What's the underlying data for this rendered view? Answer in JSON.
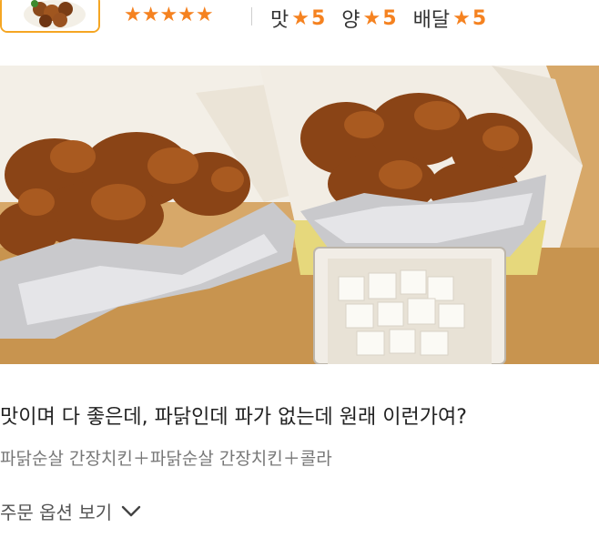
{
  "review": {
    "stars": "★★★★★",
    "ratings": [
      {
        "label": "맛",
        "star": "★",
        "score": "5"
      },
      {
        "label": "양",
        "star": "★",
        "score": "5"
      },
      {
        "label": "배달",
        "star": "★",
        "score": "5"
      }
    ],
    "text": "맛이며 다 좋은데, 파닭인데 파가 없는데 원래 이런가여?",
    "menu": "파닭순살 간장치킨＋파닭순살 간장치킨＋콜라",
    "options_label": "주문 옵션 보기"
  },
  "colors": {
    "accent": "#f58220",
    "thumb_border": "#f5a623",
    "text_main": "#222222",
    "text_sub": "#777777"
  },
  "icons": {
    "options": "chevron-down-icon"
  }
}
